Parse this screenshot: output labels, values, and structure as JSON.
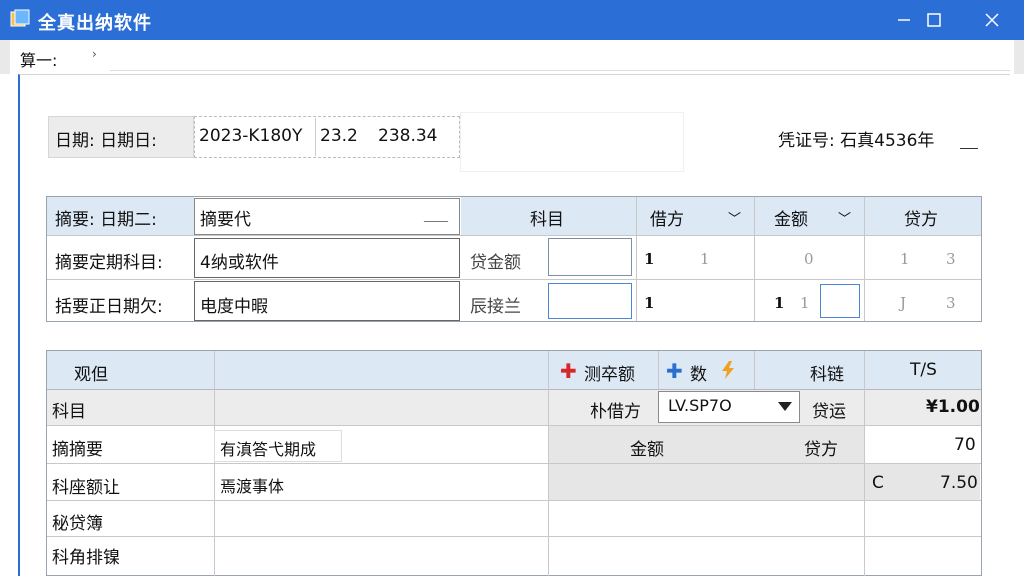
{
  "window": {
    "title": "全真出纳软件",
    "minimize": "—",
    "maximize": "☐",
    "close": "✕"
  },
  "menu": {
    "item": "算一:",
    "chevron": "›"
  },
  "header": {
    "date_label": "日期: 日期日:",
    "date_value_1": "2023-K180Y",
    "date_value_2": "23.2",
    "date_value_3": "238.34",
    "voucher_label": "凭证号: 石真4536年"
  },
  "upper_form": {
    "row1_label": "摘要: 日期二:",
    "row1_input": "摘要代",
    "row1_underline": "____",
    "row2_label": "摘要定期科目:",
    "row2_input": "4纳或软件",
    "row3_label": "括要正日期欠:",
    "row3_input": "电度中暇",
    "col_subject": "科目",
    "col_debit": "借方",
    "col_amount": "金额",
    "col_credit": "贷方",
    "row2_mid_label": "贷金额",
    "row3_mid_label": "辰接兰",
    "row2_nums": [
      "1",
      "1",
      "0",
      "1",
      "3"
    ],
    "row3_nums": [
      "1",
      "1",
      "1",
      "J",
      "3"
    ]
  },
  "lower_grid": {
    "header_col1": "观但",
    "btn_delete": "测卒额",
    "btn_add": "数",
    "header_subject": "科链",
    "header_ts": "T/S",
    "row1_label": "科目",
    "row1_field_label": "朴借方",
    "row1_select": "LV.SP7O",
    "row1_credit_label": "贷运",
    "row1_value": "¥1.00",
    "row2_label": "摘摘要",
    "row2_tag": "有滇答弋期成",
    "row2_amount": "金额",
    "row2_credit": "贷方",
    "row2_value": "70",
    "row3_label": "科座额让",
    "row3_text": "焉渡事体",
    "row3_value_a": "C",
    "row3_value_b": "7.50",
    "row4_label": "秘贷簿",
    "row5_label": "科角排镍"
  },
  "colors": {
    "titlebar": "#2b6fd6",
    "header_blue": "#dce8f4",
    "plus_red": "#d62828",
    "plus_blue": "#2a6fd0",
    "arrow_orange": "#f0a020"
  }
}
